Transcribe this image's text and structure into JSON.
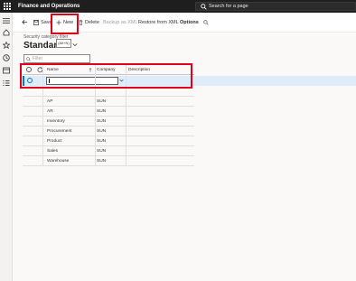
{
  "app": {
    "title": "Finance and Operations"
  },
  "search": {
    "placeholder": "Search for a page"
  },
  "toolbar": {
    "save_label": "Save",
    "new_label": "New",
    "delete_label": "Delete",
    "backup_label": "Backup as XML",
    "restore_label": "Restore from XML",
    "options_label": "Options"
  },
  "tooltip": {
    "text": "(Alt+N)"
  },
  "page": {
    "caption": "Security category filter",
    "title": "Standard"
  },
  "filter": {
    "placeholder": "Filter"
  },
  "grid": {
    "columns": {
      "name": "Name",
      "company": "Company",
      "description": "Description"
    },
    "edit_row": {
      "name_value": ""
    },
    "rows": [
      {
        "name": "AP",
        "company": "SUN",
        "description": ""
      },
      {
        "name": "AR",
        "company": "SUN",
        "description": ""
      },
      {
        "name": "Inventory",
        "company": "SUN",
        "description": ""
      },
      {
        "name": "Procurement",
        "company": "SUN",
        "description": ""
      },
      {
        "name": "Product",
        "company": "SUN",
        "description": ""
      },
      {
        "name": "Sales",
        "company": "SUN",
        "description": ""
      },
      {
        "name": "Warehouse",
        "company": "SUN",
        "description": ""
      }
    ]
  },
  "colors": {
    "accent": "#0078d4",
    "highlight": "#e3001b",
    "topbar": "#1e1e1e",
    "selected_row": "#deecf9"
  },
  "icons": [
    "waffle-icon",
    "search-icon",
    "menu-icon",
    "home-icon",
    "star-icon",
    "clock-icon",
    "workspace-icon",
    "list-icon",
    "back-icon",
    "save-icon",
    "plus-icon",
    "delete-icon",
    "chevron-down-icon",
    "filter-icon",
    "refresh-icon",
    "sort-icon"
  ]
}
